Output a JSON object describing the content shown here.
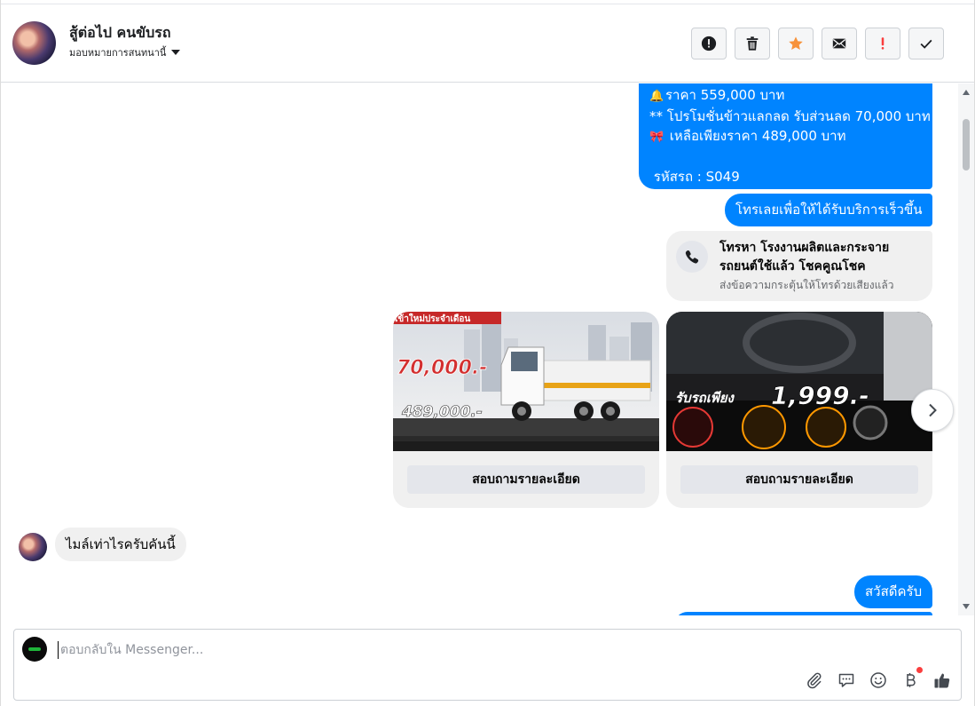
{
  "header": {
    "name": "สู้ต่อไป คนขับรถ",
    "assign_label": "มอบหมายการสนทนานี้",
    "actions": [
      {
        "name": "report-button",
        "icon": "alert-circle-icon"
      },
      {
        "name": "delete-button",
        "icon": "trash-icon"
      },
      {
        "name": "star-button",
        "icon": "star-icon"
      },
      {
        "name": "mark-unread-button",
        "icon": "envelope-icon"
      },
      {
        "name": "spam-button",
        "icon": "exclamation-icon"
      },
      {
        "name": "done-button",
        "icon": "check-icon"
      }
    ]
  },
  "messages": {
    "listing": {
      "price": "ราคา 559,000 บาท",
      "promo": "** โปรโมชั่นข้าวแลกลด รับส่วนลด 70,000 บาท",
      "final_price": "เหลือเพียงราคา 489,000 บาท",
      "code": "รหัสรถ : S049"
    },
    "call_prompt": "โทรเลยเพื่อให้ได้รับบริการเร็วขึ้น",
    "call_card": {
      "title": "โทรหา โรงงานผลิตและกระจายรถยนต์ใช้แล้ว โชคคูณโชค",
      "subtitle": "ส่งข้อความกระตุ้นให้โทรด้วยเสียงแล้ว"
    },
    "cards": [
      {
        "button": "สอบถามรายละเอียด",
        "banner": "เข้าใหม่ประจำเดือน",
        "discount": "70,000.-",
        "price": "489,000.-"
      },
      {
        "button": "สอบถามรายละเอียด",
        "headline": "รับรถเพียง",
        "amount": "1,999.-"
      }
    ],
    "incoming": "ไมล์เท่าไรครับคันนี้",
    "greeting": "สวัสดีครับ"
  },
  "composer": {
    "placeholder": "ตอบกลับใน Messenger..."
  },
  "colors": {
    "outgoing_bubble": "#0084ff",
    "incoming_bubble": "#f0f0f0",
    "star": "#f7923a",
    "spam": "#fa3e3e"
  }
}
